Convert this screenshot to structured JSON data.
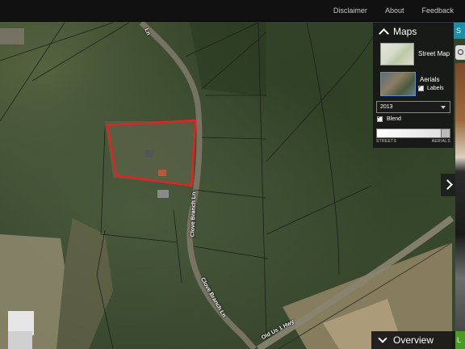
{
  "topnav": {
    "disclaimer": "Disclaimer",
    "about": "About",
    "feedback": "Feedback"
  },
  "maps_panel": {
    "title": "Maps",
    "street_map": "Street Map",
    "aerials": "Aerials",
    "labels": "Labels",
    "year": "2013",
    "blend": "Blend",
    "slider_left": "STREETS",
    "slider_right": "AERIALS",
    "slider_value": 1.0
  },
  "roads": {
    "clove_branch_1": "Clove Branch Ln",
    "clove_branch_2": "Clove Branch Ln",
    "clove_branch_top": "Ln",
    "old_us_1": "Old Us 1 Hwy"
  },
  "sidebar": {
    "tab_letter": "S",
    "green_letter": "L"
  },
  "overview": {
    "label": "Overview"
  },
  "colors": {
    "parcel_highlight": "#e32222",
    "panel_bg": "#141414",
    "accent": "#1b8fa8"
  }
}
